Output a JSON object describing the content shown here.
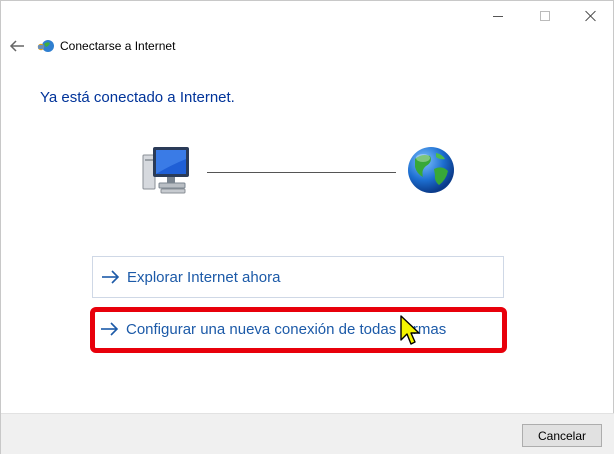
{
  "window": {
    "title": "Conectarse a Internet",
    "controls": [
      "minimize",
      "maximize",
      "close"
    ]
  },
  "main": {
    "heading": "Ya está conectado a Internet.",
    "illustration": {
      "left_icon": "computer-monitor-icon",
      "right_icon": "globe-icon"
    },
    "options": [
      {
        "label": "Explorar Internet ahora",
        "icon": "arrow-right-icon"
      },
      {
        "label": "Configurar una nueva conexión de todas formas",
        "icon": "arrow-right-icon",
        "highlighted": true
      }
    ]
  },
  "footer": {
    "cancel_label": "Cancelar"
  },
  "colors": {
    "link_text": "#1c5aa8",
    "heading_text": "#003399",
    "highlight_border": "#e8000b",
    "footer_bg": "#f0f0f0"
  }
}
